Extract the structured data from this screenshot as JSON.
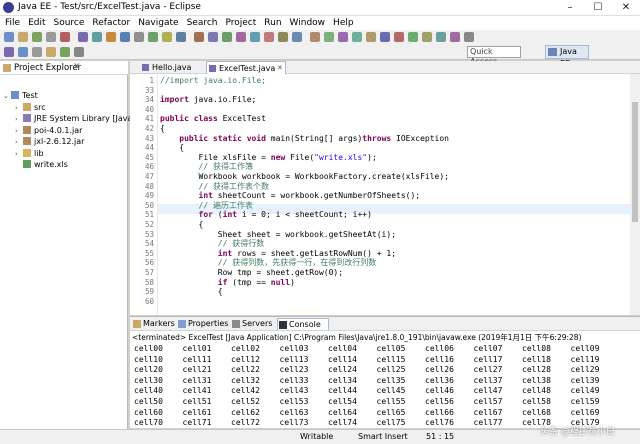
{
  "window": {
    "title": "Java EE - Test/src/ExcelTest.java - Eclipse",
    "minimize": "–",
    "maximize": "☐",
    "close": "✕"
  },
  "menu": [
    "File",
    "Edit",
    "Source",
    "Refactor",
    "Navigate",
    "Search",
    "Project",
    "Run",
    "Window",
    "Help"
  ],
  "toolbar": {
    "quick_access": "Quick Access",
    "perspective": "Java EE"
  },
  "project_explorer": {
    "title": "Project Explorer",
    "close": "✕",
    "tree": [
      {
        "label": "Test",
        "indent": 0,
        "twist": "⌄",
        "icon": "project-icon"
      },
      {
        "label": "src",
        "indent": 1,
        "twist": "›",
        "icon": "package-folder-icon"
      },
      {
        "label": "JRE System Library [JavaSE-1.8]",
        "indent": 1,
        "twist": "›",
        "icon": "library-icon"
      },
      {
        "label": "poi-4.0.1.jar",
        "indent": 1,
        "twist": "›",
        "icon": "jar-icon"
      },
      {
        "label": "jxl-2.6.12.jar",
        "indent": 1,
        "twist": "›",
        "icon": "jar-icon"
      },
      {
        "label": "lib",
        "indent": 1,
        "twist": "›",
        "icon": "folder-icon"
      },
      {
        "label": "write.xls",
        "indent": 1,
        "twist": "",
        "icon": "file-icon"
      }
    ]
  },
  "editor": {
    "tabs": [
      {
        "label": "Hello.java"
      },
      {
        "label": "ExcelTest.java",
        "close": "✕"
      }
    ],
    "lines": [
      {
        "n": "1",
        "parts": [
          [
            "cm",
            "//import java.io.File;"
          ]
        ]
      },
      {
        "n": "33",
        "parts": []
      },
      {
        "n": "34",
        "parts": [
          [
            "kw",
            "import"
          ],
          [
            "",
            " java.io.File;"
          ]
        ]
      },
      {
        "n": "40",
        "parts": []
      },
      {
        "n": "41",
        "parts": [
          [
            "kw",
            "public class"
          ],
          [
            "",
            " ExcelTest"
          ]
        ]
      },
      {
        "n": "42",
        "parts": [
          [
            "",
            "{"
          ]
        ]
      },
      {
        "n": "43",
        "parts": [
          [
            "",
            "    "
          ],
          [
            "kw",
            "public static void"
          ],
          [
            "",
            " main(String[] args)"
          ],
          [
            "kw",
            "throws"
          ],
          [
            "",
            " IOException"
          ]
        ]
      },
      {
        "n": "44",
        "parts": [
          [
            "",
            "    {"
          ]
        ]
      },
      {
        "n": "45",
        "parts": [
          [
            "",
            "        File xlsFile = "
          ],
          [
            "kw",
            "new"
          ],
          [
            "",
            " File("
          ],
          [
            "str",
            "\"write.xls\""
          ],
          [
            "",
            ");"
          ]
        ]
      },
      {
        "n": "46",
        "parts": [
          [
            "cm",
            "        // 获得工作簿"
          ]
        ]
      },
      {
        "n": "47",
        "parts": [
          [
            "",
            "        Workbook workbook = WorkbookFactory.create(xlsFile);"
          ]
        ]
      },
      {
        "n": "48",
        "parts": [
          [
            "cm",
            "        // 获得工作表个数"
          ]
        ]
      },
      {
        "n": "49",
        "parts": [
          [
            "",
            "        "
          ],
          [
            "kw",
            "int"
          ],
          [
            "",
            " sheetCount = workbook.getNumberOfSheets();"
          ]
        ]
      },
      {
        "n": "50",
        "parts": [
          [
            "cm",
            "        // 遍历工作表"
          ]
        ]
      },
      {
        "n": "51",
        "parts": [
          [
            "",
            "        "
          ],
          [
            "kw",
            "for"
          ],
          [
            "",
            " ("
          ],
          [
            "kw",
            "int"
          ],
          [
            "",
            " i = 0; i < sheetCount; i++)"
          ]
        ]
      },
      {
        "n": "52",
        "parts": [
          [
            "",
            "        {"
          ]
        ]
      },
      {
        "n": "53",
        "parts": [
          [
            "",
            "            Sheet sheet = workbook.getSheetAt(i);"
          ]
        ]
      },
      {
        "n": "54",
        "parts": [
          [
            "cm",
            "            // 获得行数"
          ]
        ]
      },
      {
        "n": "55",
        "parts": [
          [
            "",
            "            "
          ],
          [
            "kw",
            "int"
          ],
          [
            "",
            " rows = sheet.getLastRowNum() + 1;"
          ]
        ]
      },
      {
        "n": "56",
        "parts": [
          [
            "cm",
            "            // 获得列数，先获得一行，在得到改行列数"
          ]
        ]
      },
      {
        "n": "57",
        "parts": [
          [
            "",
            "            Row tmp = sheet.getRow(0);"
          ]
        ]
      },
      {
        "n": "58",
        "parts": [
          [
            "",
            "            "
          ],
          [
            "kw",
            "if"
          ],
          [
            "",
            " (tmp == "
          ],
          [
            "kw",
            "null"
          ],
          [
            "",
            ")"
          ]
        ]
      },
      {
        "n": "59",
        "parts": [
          [
            "",
            "            {"
          ]
        ]
      },
      {
        "n": "60",
        "parts": [
          [
            "",
            "            "
          ]
        ]
      }
    ]
  },
  "console_view": {
    "tabs": [
      "Markers",
      "Properties",
      "Servers",
      "Console"
    ],
    "terminated": "<terminated> ExcelTest [Java Application] C:\\Program Files\\Java\\jre1.8.0_191\\bin\\javaw.exe (2019年1月1日 下午6:29:28)",
    "rows": [
      [
        "cell00",
        "cell01",
        "cell02",
        "cell03",
        "cell04",
        "cell05",
        "cell06",
        "cell07",
        "cell08",
        "cell09"
      ],
      [
        "cell10",
        "cell11",
        "cell12",
        "cell13",
        "cell14",
        "cell15",
        "cell16",
        "cell17",
        "cell18",
        "cell19"
      ],
      [
        "cell20",
        "cell21",
        "cell22",
        "cell23",
        "cell24",
        "cell25",
        "cell26",
        "cell27",
        "cell28",
        "cell29"
      ],
      [
        "cell30",
        "cell31",
        "cell32",
        "cell33",
        "cell34",
        "cell35",
        "cell36",
        "cell37",
        "cell38",
        "cell39"
      ],
      [
        "cell40",
        "cell41",
        "cell42",
        "cell43",
        "cell44",
        "cell45",
        "cell46",
        "cell47",
        "cell48",
        "cell49"
      ],
      [
        "cell50",
        "cell51",
        "cell52",
        "cell53",
        "cell54",
        "cell55",
        "cell56",
        "cell57",
        "cell58",
        "cell59"
      ],
      [
        "cell60",
        "cell61",
        "cell62",
        "cell63",
        "cell64",
        "cell65",
        "cell66",
        "cell67",
        "cell68",
        "cell69"
      ],
      [
        "cell70",
        "cell71",
        "cell72",
        "cell73",
        "cell74",
        "cell75",
        "cell76",
        "cell77",
        "cell78",
        "cell79"
      ]
    ]
  },
  "status": {
    "writable": "Writable",
    "insert": "Smart Insert",
    "position": "51 : 15"
  },
  "watermark": "头条 @程序员小白"
}
